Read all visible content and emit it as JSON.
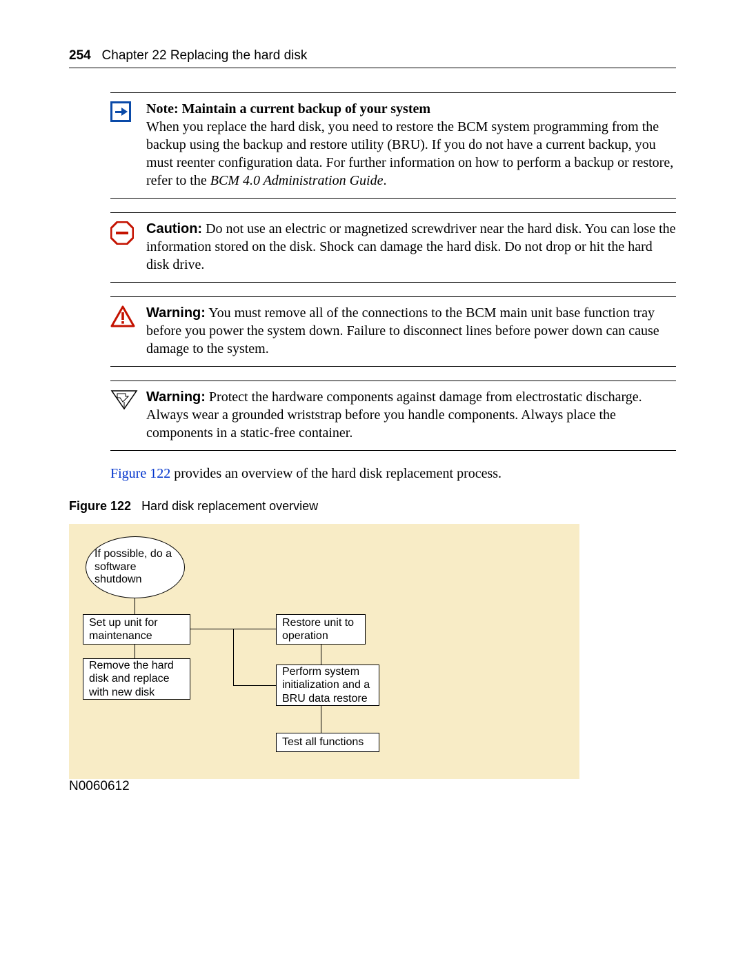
{
  "header": {
    "page_number": "254",
    "chapter": "Chapter 22  Replacing the hard disk"
  },
  "callouts": {
    "note": {
      "label": "Note:",
      "subtitle": "Maintain a current backup of your system",
      "body_pre_italic": "When you replace the hard disk, you need to restore the BCM system programming from the backup using the backup and restore utility (BRU). If you do not have a current backup, you must reenter configuration data. For further information on how to perform a backup or restore, refer to the ",
      "italic": "BCM 4.0 Administration Guide",
      "body_post_italic": "."
    },
    "caution": {
      "label": "Caution:",
      "body": "Do not use an electric or magnetized screwdriver near the hard disk. You can lose the information stored on the disk. Shock can damage the hard disk. Do not drop or hit the hard disk drive."
    },
    "warning1": {
      "label": "Warning:",
      "body": "You must remove all of the connections to the BCM main unit base function tray before you power the system down. Failure to disconnect lines before power down can cause damage to the system."
    },
    "warning2": {
      "label": "Warning:",
      "body": "Protect the hardware components against damage from electrostatic discharge. Always wear a grounded wriststrap before you handle components. Always place the components in a static-free container."
    }
  },
  "sentence": {
    "link": "Figure 122",
    "rest": " provides an overview of the hard disk replacement process."
  },
  "figure": {
    "label": "Figure 122",
    "caption": "Hard disk replacement overview"
  },
  "diagram": {
    "n1": "If possible, do a software shutdown",
    "n2": "Set up unit for maintenance",
    "n3": "Remove the hard disk and replace with new disk",
    "n4": "Restore unit to operation",
    "n5": "Perform system initialization and a BRU data restore",
    "n6": "Test all functions"
  },
  "footer": {
    "doc_id": "N0060612"
  }
}
